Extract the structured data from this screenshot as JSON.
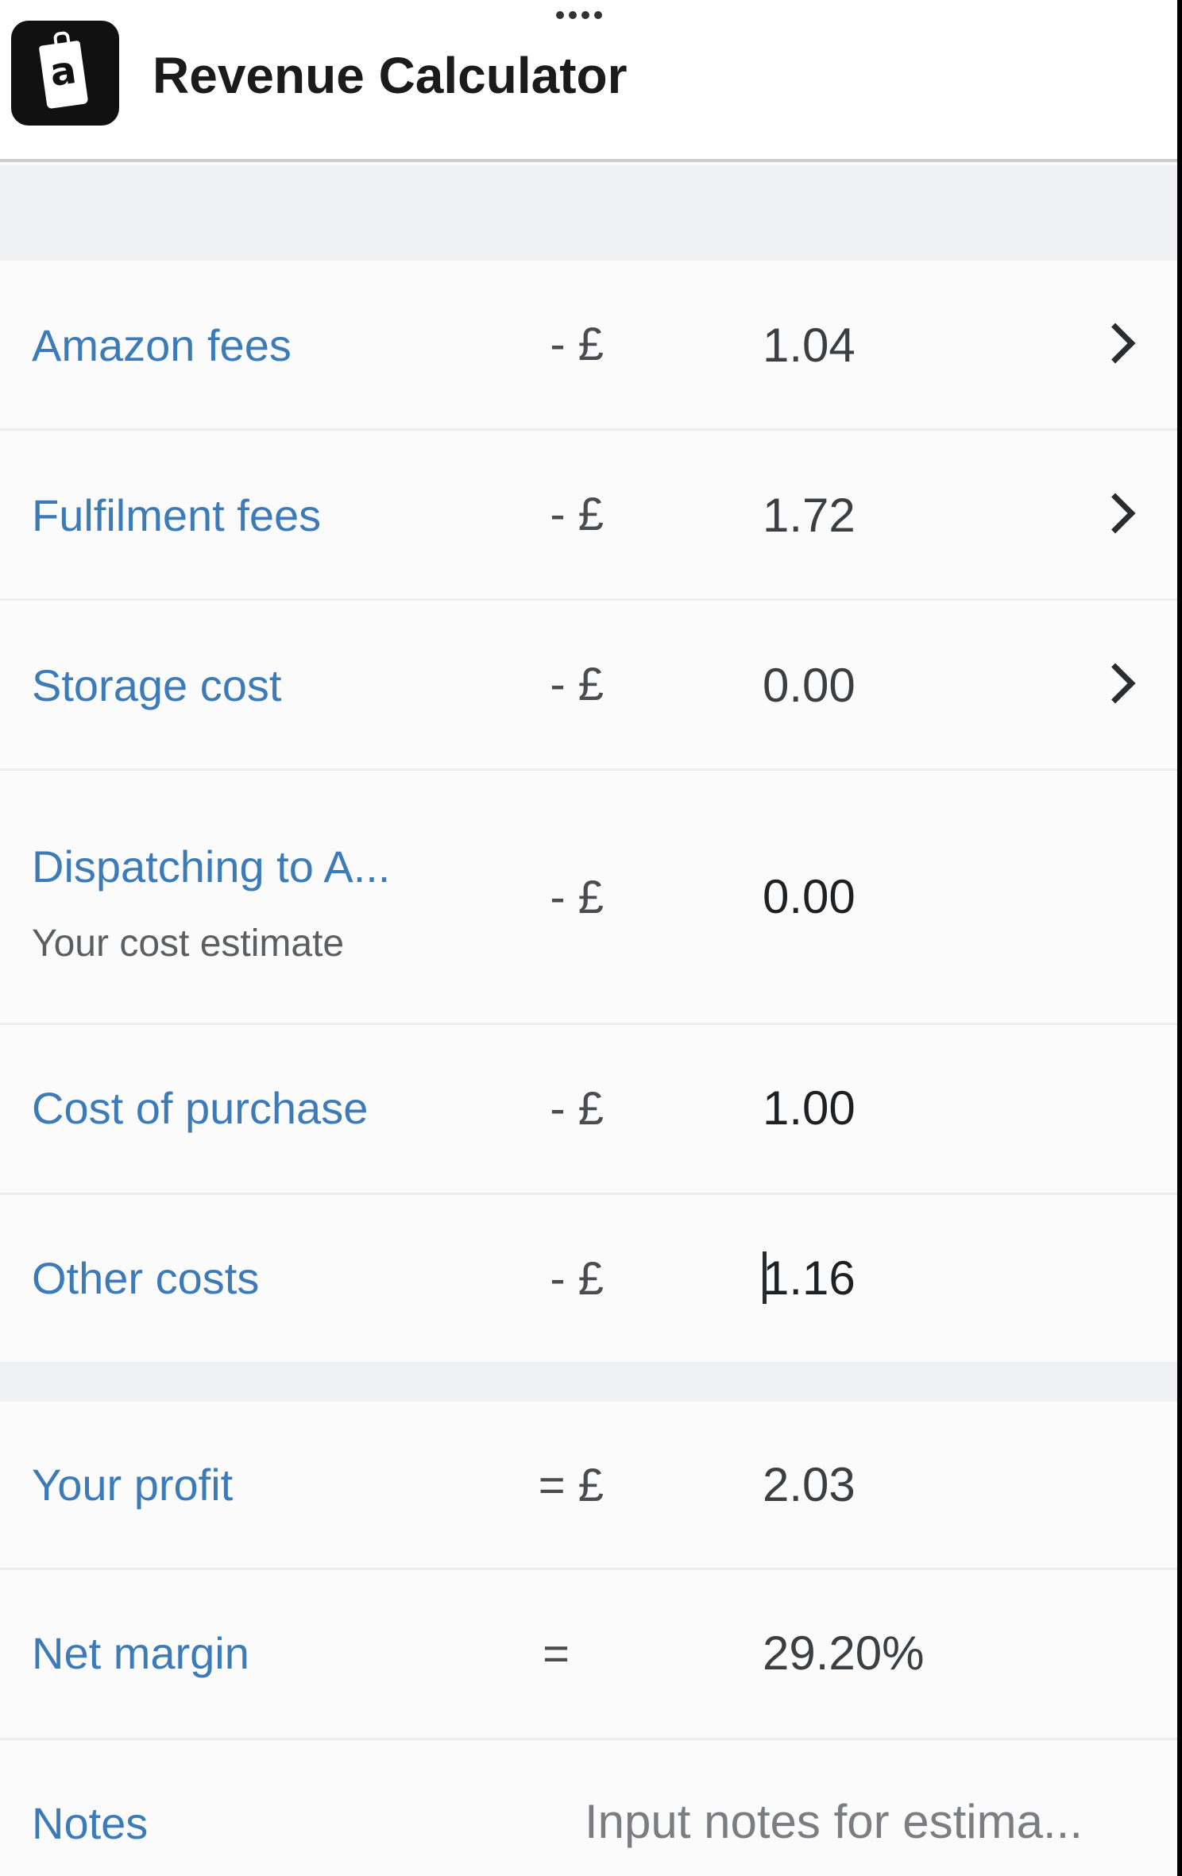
{
  "app": {
    "title": "Revenue Calculator",
    "icon_letter": "a"
  },
  "rows": {
    "amazon_fees": {
      "label": "Amazon fees",
      "op": "- £",
      "value": "1.04"
    },
    "fulfilment_fees": {
      "label": "Fulfilment fees",
      "op": "- £",
      "value": "1.72"
    },
    "storage_cost": {
      "label": "Storage cost",
      "op": "- £",
      "value": "0.00"
    },
    "dispatching": {
      "label": "Dispatching to A...",
      "sublabel": "Your cost estimate",
      "op": "- £",
      "value": "0.00"
    },
    "cost_of_purchase": {
      "label": "Cost of purchase",
      "op": "- £",
      "value": "1.00"
    },
    "other_costs": {
      "label": "Other costs",
      "op": "- £",
      "value": "1.16"
    },
    "your_profit": {
      "label": "Your profit",
      "op": "= £",
      "value": "2.03"
    },
    "net_margin": {
      "label": "Net margin",
      "op": "=",
      "value": "29.20%"
    },
    "notes": {
      "label": "Notes",
      "placeholder": "Input notes for estima..."
    }
  },
  "colors": {
    "label": "#3c7bb8",
    "value": "#3c3f42",
    "divider": "#ebedef",
    "section_gap": "#eef0f2"
  },
  "icons": [
    "amazon-app-icon",
    "chevron-right-icon"
  ]
}
